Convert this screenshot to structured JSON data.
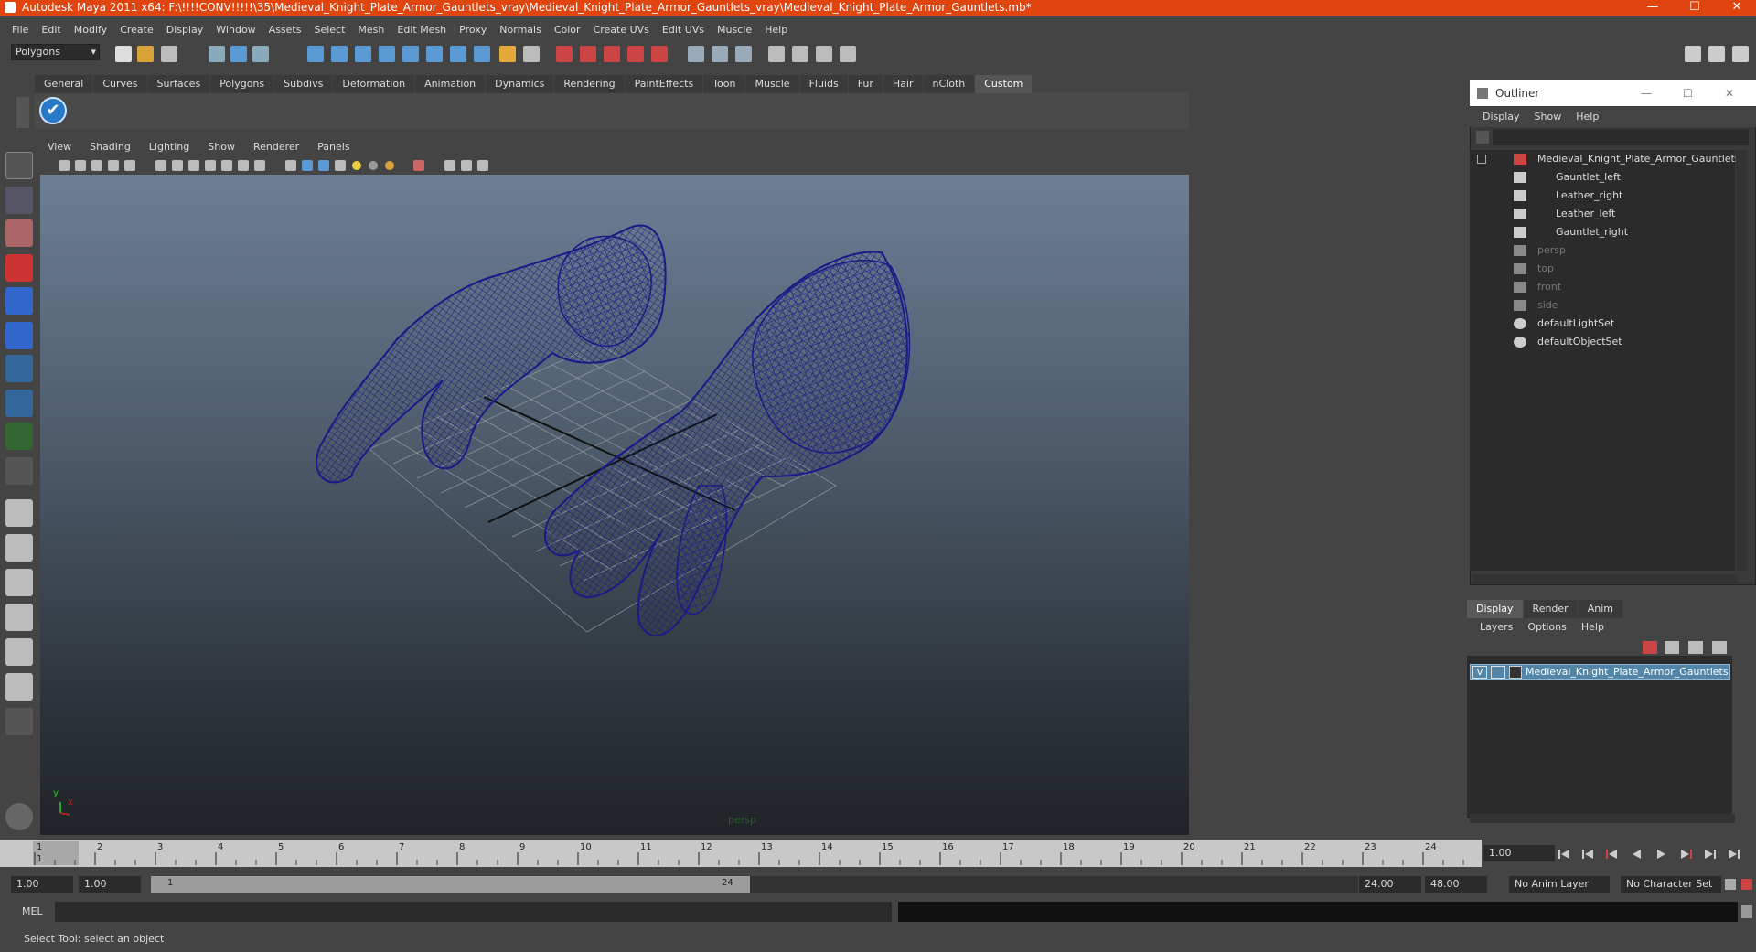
{
  "window": {
    "title": "Autodesk Maya 2011 x64: F:\\!!!!CONV!!!!!\\35\\Medieval_Knight_Plate_Armor_Gauntlets_vray\\Medieval_Knight_Plate_Armor_Gauntlets_vray\\Medieval_Knight_Plate_Armor_Gauntlets.mb*",
    "min": "—",
    "max": "☐",
    "close": "✕"
  },
  "menubar": [
    "File",
    "Edit",
    "Modify",
    "Create",
    "Display",
    "Window",
    "Assets",
    "Select",
    "Mesh",
    "Edit Mesh",
    "Proxy",
    "Normals",
    "Color",
    "Create UVs",
    "Edit UVs",
    "Muscle",
    "Help"
  ],
  "statusline": {
    "mode": "Polygons"
  },
  "shelf": {
    "tabs": [
      "General",
      "Curves",
      "Surfaces",
      "Polygons",
      "Subdivs",
      "Deformation",
      "Animation",
      "Dynamics",
      "Rendering",
      "PaintEffects",
      "Toon",
      "Muscle",
      "Fluids",
      "Fur",
      "Hair",
      "nCloth",
      "Custom"
    ],
    "active": "Custom",
    "check_icon": "✔"
  },
  "viewport": {
    "menu": [
      "View",
      "Shading",
      "Lighting",
      "Show",
      "Renderer",
      "Panels"
    ],
    "camera_label": "persp",
    "axis_y": "y",
    "axis_x": "x"
  },
  "outliner": {
    "title": "Outliner",
    "menu": [
      "Display",
      "Show",
      "Help"
    ],
    "items": [
      {
        "label": "Medieval_Knight_Plate_Armor_Gauntlets",
        "dim": false
      },
      {
        "label": "Gauntlet_left",
        "dim": false
      },
      {
        "label": "Leather_right",
        "dim": false
      },
      {
        "label": "Leather_left",
        "dim": false
      },
      {
        "label": "Gauntlet_right",
        "dim": false
      },
      {
        "label": "persp",
        "dim": true
      },
      {
        "label": "top",
        "dim": true
      },
      {
        "label": "front",
        "dim": true
      },
      {
        "label": "side",
        "dim": true
      },
      {
        "label": "defaultLightSet",
        "dim": false
      },
      {
        "label": "defaultObjectSet",
        "dim": false
      }
    ]
  },
  "layers": {
    "tabs": [
      "Display",
      "Render",
      "Anim"
    ],
    "active": "Display",
    "menu": [
      "Layers",
      "Options",
      "Help"
    ],
    "row": {
      "visible": "V",
      "name": "Medieval_Knight_Plate_Armor_Gauntlets_layer"
    }
  },
  "timeline": {
    "ticks": [
      "1",
      "2",
      "3",
      "4",
      "5",
      "6",
      "7",
      "8",
      "9",
      "10",
      "11",
      "12",
      "13",
      "14",
      "15",
      "16",
      "17",
      "18",
      "19",
      "20",
      "21",
      "22",
      "23",
      "24"
    ],
    "current_frame": "1",
    "frame_field": "1.00"
  },
  "range": {
    "start": "1.00",
    "anim_start": "1.00",
    "knob_start": "1",
    "knob_end": "24",
    "end": "24.00",
    "anim_end": "48.00",
    "anim_layer": "No Anim Layer",
    "char_set": "No Character Set"
  },
  "cmdline": {
    "label": "MEL"
  },
  "status": {
    "help": "Select Tool: select an object"
  }
}
